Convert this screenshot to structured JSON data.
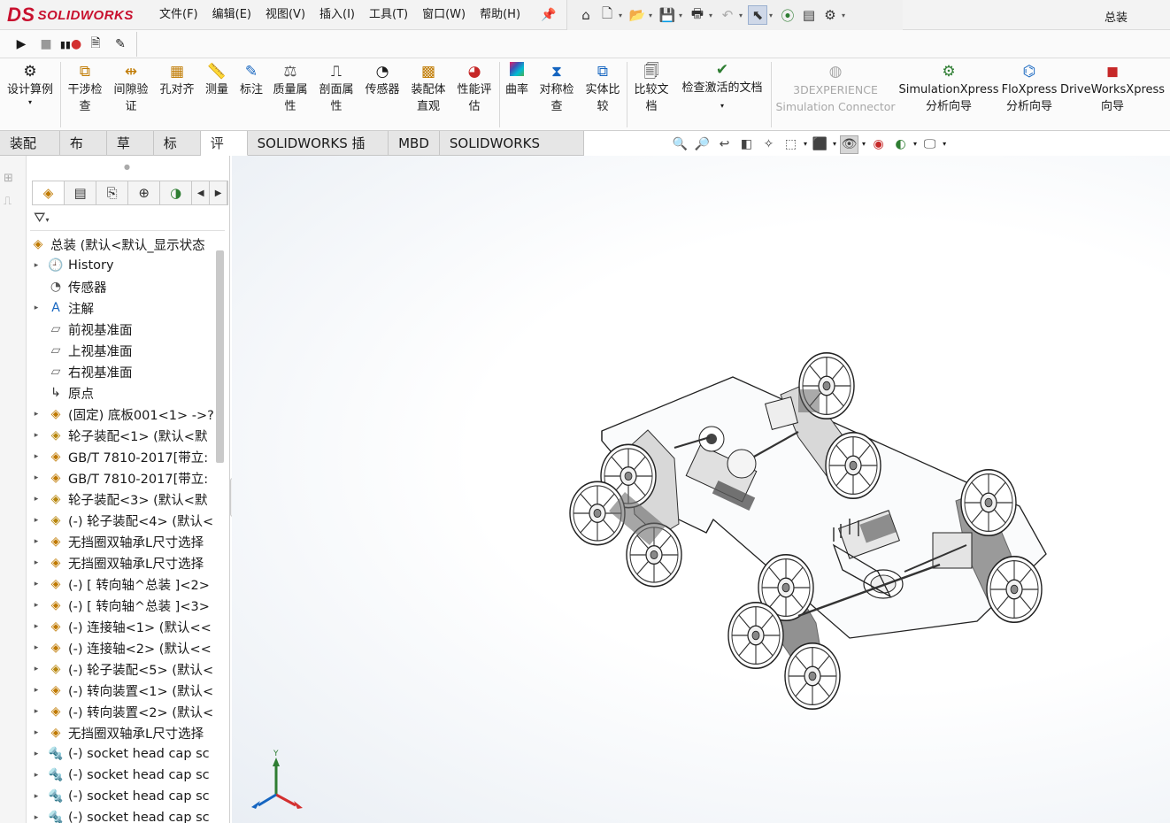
{
  "app": {
    "logo_text": "SOLIDWORKS",
    "logo_mark": "DS",
    "document_title": "总装"
  },
  "menu": [
    "文件(F)",
    "编辑(E)",
    "视图(V)",
    "插入(I)",
    "工具(T)",
    "窗口(W)",
    "帮助(H)"
  ],
  "quick_access": [
    "home-icon",
    "new-icon",
    "open-icon",
    "save-icon",
    "print-icon",
    "undo-icon",
    "select-icon",
    "rebuild-icon",
    "file-properties-icon",
    "options-icon"
  ],
  "macro_toolbar": [
    "run-macro-icon",
    "stop-macro-icon",
    "record-pause-macro-icon",
    "new-macro-icon",
    "edit-macro-icon"
  ],
  "ribbon": {
    "design_study": "设计算例",
    "interference_check": "干涉检\n查",
    "clearance_verify": "间隙验\n证",
    "hole_alignment": "孔对齐",
    "measure": "测量",
    "markup": "标注",
    "mass_properties": "质量属\n性",
    "section_properties": "剖面属\n性",
    "sensor": "传感器",
    "assembly_visualization": "装配体\n直观",
    "performance_evaluation": "性能评\n估",
    "curvature": "曲率",
    "symmetry_check": "对称检\n查",
    "compare_geometry": "实体比\n较",
    "compare_documents": "比较文\n档",
    "check_active_document": "检查激活的文档",
    "threedx_connector": "3DEXPERIENCE\nSimulation Connector",
    "simulation_xpress": "SimulationXpress\n分析向导",
    "flo_xpress": "FloXpress\n分析向导",
    "drive_works_xpress": "DriveWorksXpress\n向导"
  },
  "tabs": [
    "装配体",
    "布局",
    "草图",
    "标注",
    "评估",
    "SOLIDWORKS 插件",
    "MBD",
    "SOLIDWORKS CAM"
  ],
  "active_tab": "评估",
  "feature_tree": {
    "root": "总装  (默认<默认_显示状态",
    "items": [
      {
        "label": "History",
        "icon": "history-icon",
        "expand": true
      },
      {
        "label": "传感器",
        "icon": "sensor-icon",
        "expand": false
      },
      {
        "label": "注解",
        "icon": "annotation-icon",
        "expand": true
      },
      {
        "label": "前视基准面",
        "icon": "plane-icon",
        "expand": false
      },
      {
        "label": "上视基准面",
        "icon": "plane-icon",
        "expand": false
      },
      {
        "label": "右视基准面",
        "icon": "plane-icon",
        "expand": false
      },
      {
        "label": "原点",
        "icon": "origin-icon",
        "expand": false
      },
      {
        "label": "(固定) 底板001<1> ->?",
        "icon": "part-icon",
        "expand": true
      },
      {
        "label": "轮子装配<1> (默认<默",
        "icon": "subassembly-icon",
        "expand": true
      },
      {
        "label": "GB/T 7810-2017[带立:",
        "icon": "part-icon",
        "expand": true
      },
      {
        "label": "GB/T 7810-2017[带立:",
        "icon": "part-icon",
        "expand": true
      },
      {
        "label": "轮子装配<3> (默认<默",
        "icon": "subassembly-icon",
        "expand": true
      },
      {
        "label": "(-) 轮子装配<4> (默认<",
        "icon": "subassembly-icon",
        "expand": true
      },
      {
        "label": "无挡圈双轴承L尺寸选择",
        "icon": "part-icon",
        "expand": true
      },
      {
        "label": "无挡圈双轴承L尺寸选择",
        "icon": "part-icon",
        "expand": true
      },
      {
        "label": "(-) [ 转向轴^总装 ]<2>",
        "icon": "part-icon",
        "expand": true
      },
      {
        "label": "(-) [ 转向轴^总装 ]<3>",
        "icon": "part-icon",
        "expand": true
      },
      {
        "label": "(-) 连接轴<1> (默认<<",
        "icon": "part-icon",
        "expand": true
      },
      {
        "label": "(-) 连接轴<2> (默认<<",
        "icon": "part-icon",
        "expand": true
      },
      {
        "label": "(-) 轮子装配<5> (默认<",
        "icon": "subassembly-icon",
        "expand": true
      },
      {
        "label": "(-) 转向装置<1> (默认<",
        "icon": "part-icon",
        "expand": true
      },
      {
        "label": "(-) 转向装置<2> (默认<",
        "icon": "part-icon",
        "expand": true
      },
      {
        "label": "无挡圈双轴承L尺寸选择",
        "icon": "part-icon",
        "expand": true
      },
      {
        "label": "(-) socket head cap sc",
        "icon": "screw-icon",
        "expand": true
      },
      {
        "label": "(-) socket head cap sc",
        "icon": "screw-icon",
        "expand": true
      },
      {
        "label": "(-) socket head cap sc",
        "icon": "screw-icon",
        "expand": true
      },
      {
        "label": "(-) socket head cap sc",
        "icon": "screw-icon",
        "expand": true
      }
    ]
  },
  "colors": {
    "brand": "#c8102e",
    "triad_x": "#d32f2f",
    "triad_y": "#2e7d32",
    "triad_z": "#1565c0"
  }
}
